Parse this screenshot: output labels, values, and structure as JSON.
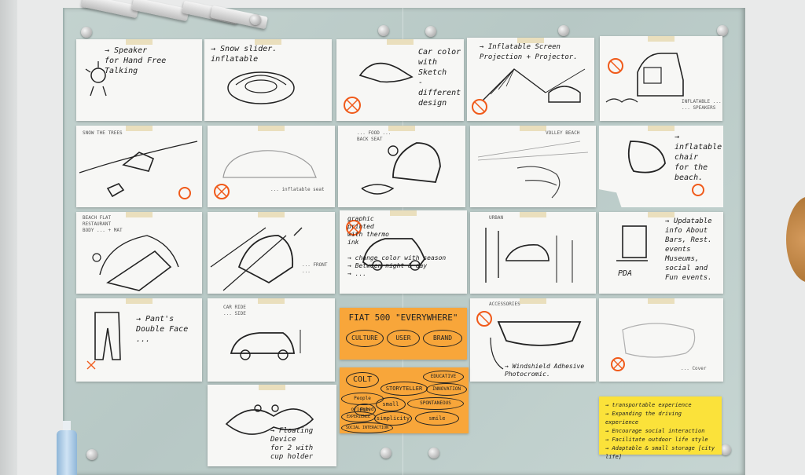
{
  "cards": [
    {
      "id": "speaker",
      "text": "→ Speaker\nfor Hand Free\nTalking",
      "caption": ""
    },
    {
      "id": "snow-slider",
      "text": "→ Snow slider.\ninflatable",
      "caption": ""
    },
    {
      "id": "car-color",
      "text": "Car color\nwith\nSketch\n- different\ndesign",
      "caption": ""
    },
    {
      "id": "inflatable-screen",
      "text": "→ Inflatable Screen\nProjection + Projector.",
      "caption": ""
    },
    {
      "id": "hatch-car",
      "text": "",
      "caption": "INFLATABLE ...\n... SPEAKERS"
    },
    {
      "id": "snow-trees",
      "text": "",
      "caption": "SNOW THE TREES"
    },
    {
      "id": "car-outline",
      "text": "",
      "caption": "... inflatable seat"
    },
    {
      "id": "flower-car",
      "text": "",
      "caption": "... FOOD ...\nBACK SEAT"
    },
    {
      "id": "beach-road",
      "text": "",
      "caption": "VOLLEY BEACH"
    },
    {
      "id": "inflatable-chair",
      "text": "→ inflatable\nchair\nfor the\nbeach.",
      "caption": ""
    },
    {
      "id": "beach-flat",
      "text": "",
      "caption": "BEACH FLAT\nRESTAURANT\nBODY ... + MAT"
    },
    {
      "id": "road-car",
      "text": "",
      "caption": "... FRONT ..."
    },
    {
      "id": "graphic-painted",
      "text": "graphic\nprinted\nwith thermo\nink\n\n→ change color with season\n→ Between night & day\n→ ...",
      "caption": ""
    },
    {
      "id": "street-scene",
      "text": "",
      "caption": "URBAN"
    },
    {
      "id": "updatable-info",
      "text": "→ Updatable\ninfo About\nBars, Rest.\nevents\nMuseums,\nsocial and\nFun events.",
      "caption": "PDA"
    },
    {
      "id": "pants",
      "text": "→ Pant's\nDouble Face\n...",
      "caption": ""
    },
    {
      "id": "car-rain",
      "text": "",
      "caption": "CAR RIDE\n... SIDE"
    },
    {
      "id": "windshield",
      "text": "→ Windshield Adhesive\nPhotocromic.",
      "caption": "ACCESSORIES"
    },
    {
      "id": "faint-sketch",
      "text": "",
      "caption": "... Cover"
    },
    {
      "id": "floating-device",
      "text": "→ Floating\nDevice\nfor 2 with\ncup holder",
      "caption": ""
    }
  ],
  "fiat": {
    "title": "FIAT 500 \"EVERYWHERE\"",
    "ovals": [
      "CULTURE",
      "USER",
      "BRAND"
    ]
  },
  "colt": {
    "title": "COLT",
    "ovals": [
      "STORYTELLER",
      "EDUCATIVE",
      "INNOVATION",
      "People oriented",
      "Fun",
      "small",
      "SPONTANEOUS",
      "EXPERIENCE",
      "simplicity",
      "smile",
      "SOCIAL INTERACTION"
    ]
  },
  "sticky": {
    "items": [
      "→ transportable experience",
      "→ Expanding the driving experience",
      "→ Encourage social interaction",
      "→ Facilitate outdoor life style",
      "→ Adaptable & small storage [city life]"
    ]
  },
  "colors": {
    "board": "#bccdca",
    "card": "#f7f7f5",
    "orange": "#f8a63a",
    "sticky": "#fbe23a",
    "marker": "#f05a1a"
  }
}
